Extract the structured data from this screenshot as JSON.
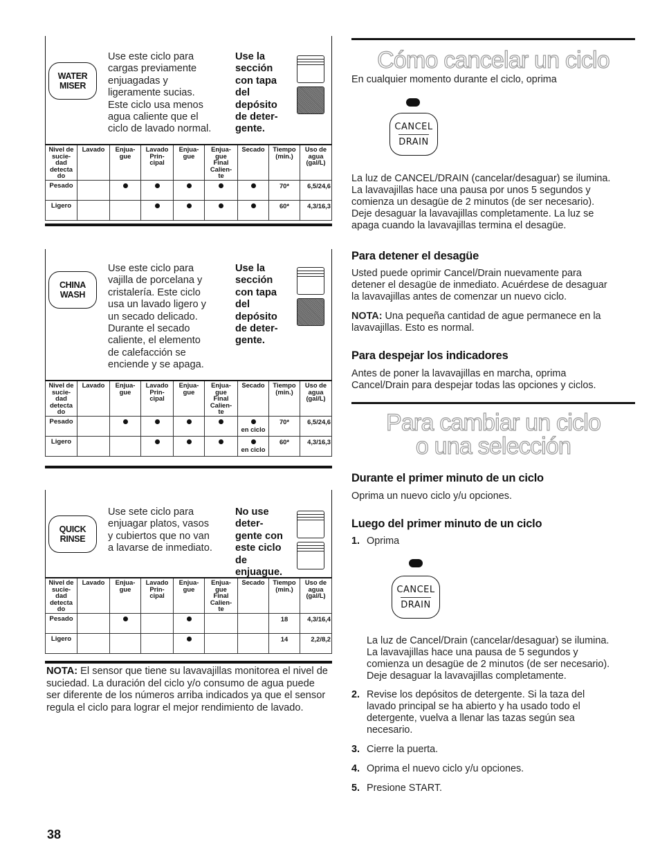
{
  "page_number": "38",
  "table_headers": [
    "Nivel de sucie-dad detecta do",
    "Lavado",
    "Enjua-gue",
    "Lavado Prin-cipal",
    "Enjua-gue",
    "Enjua-gue Final Calien-te",
    "Secado",
    "Tiempo (min.)",
    "Uso de agua (gal/L)"
  ],
  "table_headers_lines": [
    [
      "Nivel de",
      "sucie-",
      "dad",
      "detecta",
      "do"
    ],
    [
      "Lavado"
    ],
    [
      "Enjua-",
      "gue"
    ],
    [
      "Lavado",
      "Prin-",
      "cipal"
    ],
    [
      "Enjua-",
      "gue"
    ],
    [
      "Enjua-",
      "gue",
      "Final",
      "Calien-",
      "te"
    ],
    [
      "Secado"
    ],
    [
      "Tiempo",
      "(min.)"
    ],
    [
      "Uso de",
      "agua",
      "(gal/L)"
    ]
  ],
  "cycles": [
    {
      "button_lines": [
        "WATER",
        "MISER"
      ],
      "description_lines": [
        "Use este ciclo para",
        "cargas previamente",
        "enjuagadas y",
        "ligeramente sucias.",
        "Este ciclo usa menos",
        "agua caliente que el",
        "ciclo de lavado normal."
      ],
      "detergent_lines": [
        "Use la",
        "sección",
        "con tapa",
        "del",
        "depósito",
        "de deter-",
        "gente."
      ],
      "dispenser": [
        "covered-cup",
        "filled-cup"
      ],
      "rows": [
        {
          "level": "Pesado",
          "marks": [
            false,
            true,
            true,
            true,
            true,
            true
          ],
          "dry_note": "",
          "time": "70*",
          "water": "6,5/24,6"
        },
        {
          "level": "Ligero",
          "marks": [
            false,
            false,
            true,
            true,
            true,
            true
          ],
          "dry_note": "",
          "time": "60*",
          "water": "4,3/16,3"
        }
      ]
    },
    {
      "button_lines": [
        "CHINA",
        "WASH"
      ],
      "description_lines": [
        "Use este ciclo para",
        "vajilla de porcelana y",
        "cristalería.  Este ciclo",
        "usa un lavado ligero y",
        "un secado delicado.",
        "Durante el secado",
        "caliente, el elemento",
        "de calefacción se",
        "enciende y se apaga."
      ],
      "detergent_lines": [
        "Use la",
        "sección",
        "con tapa",
        "del",
        "depósito",
        "de deter-",
        "gente."
      ],
      "dispenser": [
        "covered-cup",
        "filled-cup"
      ],
      "rows": [
        {
          "level": "Pesado",
          "marks": [
            false,
            true,
            true,
            true,
            true,
            true
          ],
          "dry_note": "en ciclo",
          "time": "70*",
          "water": "6,5/24,6"
        },
        {
          "level": "Ligero",
          "marks": [
            false,
            false,
            true,
            true,
            true,
            true
          ],
          "dry_note": "en ciclo",
          "time": "60*",
          "water": "4,3/16,3"
        }
      ]
    },
    {
      "button_lines": [
        "QUICK",
        "RINSE"
      ],
      "description_lines": [
        "Use sete ciclo para",
        "enjuagar platos, vasos",
        "y cubiertos que no van",
        "a lavarse de inmediato."
      ],
      "detergent_lines": [
        "No use",
        "deter-",
        "gente con",
        "este ciclo",
        "de",
        "enjuague."
      ],
      "dispenser": [
        "covered-cup",
        "covered-cup"
      ],
      "rows": [
        {
          "level": "Pesado",
          "marks": [
            false,
            true,
            false,
            true,
            false,
            false
          ],
          "dry_note": "",
          "time": "18",
          "water": "4,3/16,4"
        },
        {
          "level": "Ligero",
          "marks": [
            false,
            false,
            false,
            true,
            false,
            false
          ],
          "dry_note": "",
          "time": "14",
          "water": "2,2/8,2"
        }
      ]
    }
  ],
  "left_note": {
    "label": "NOTA:",
    "text": " El sensor que tiene su lavavajillas monitorea el nivel de suciedad. La duración del ciclo y/o consumo de agua puede ser diferente de los números arriba indicados ya que el sensor regula el ciclo para lograr el mejor rendimiento de lavado."
  },
  "cancel_section": {
    "title": "Cómo cancelar un ciclo",
    "intro": "En cualquier momento durante el ciclo, oprima",
    "button": {
      "top": "CANCEL",
      "bottom": "DRAIN"
    },
    "after_lines": [
      "La luz de CANCEL/DRAIN (cancelar/desaguar) se ilumina.",
      "La lavavajillas hace una pausa por unos 5 segundos y",
      "comienza un desagüe de 2 minutos (de ser necesario).",
      "Deje desaguar la lavavajillas completamente. La luz se",
      "apaga cuando la lavavajillas termina el desagüe."
    ],
    "stop_drain": {
      "heading": "Para detener el desagüe",
      "lines": [
        "Usted puede oprimir Cancel/Drain nuevamente para",
        "detener el desagüe de inmediato. Acuérdese de desaguar",
        "la lavavajillas antes de comenzar un nuevo ciclo."
      ],
      "note_label": "NOTA:",
      "note_lines": [
        " Una pequeña cantidad de ague permanece en la",
        "lavavajillas. Esto es normal."
      ]
    },
    "clear_indicators": {
      "heading": "Para despejar los indicadores",
      "lines": [
        "Antes de poner la lavavajillas en marcha, oprima",
        "Cancel/Drain para despejar todas las opciones y ciclos."
      ]
    }
  },
  "change_section": {
    "title_lines": [
      "Para cambiar un ciclo",
      "o una selección"
    ],
    "first_minute": {
      "heading": "Durante el primer minuto de un ciclo",
      "text": "Oprima un nuevo ciclo y/u opciones."
    },
    "after_first_minute": {
      "heading": "Luego del primer minuto de un ciclo",
      "step1": {
        "num": "1.",
        "text": "Oprima"
      },
      "button": {
        "top": "CANCEL",
        "bottom": "DRAIN"
      },
      "step1_after_lines": [
        "La luz de Cancel/Drain (cancelar/desaguar) se ilumina.",
        "La lavavajillas hace una pausa de 5 segundos y",
        "comienza un desagüe de 2 minutos (de ser necesario).",
        "Deje desaguar la lavavajillas completamente."
      ],
      "steps": [
        {
          "num": "2.",
          "lines": [
            "Revise los depósitos de detergente. Si la taza del",
            "lavado principal se ha abierto y ha usado todo el",
            "detergente, vuelva a llenar las tazas según sea",
            "necesario."
          ]
        },
        {
          "num": "3.",
          "lines": [
            "Cierre la puerta."
          ]
        },
        {
          "num": "4.",
          "lines": [
            "Oprima el nuevo ciclo y/u opciones."
          ]
        },
        {
          "num": "5.",
          "lines": [
            "Presione START."
          ]
        }
      ]
    }
  }
}
